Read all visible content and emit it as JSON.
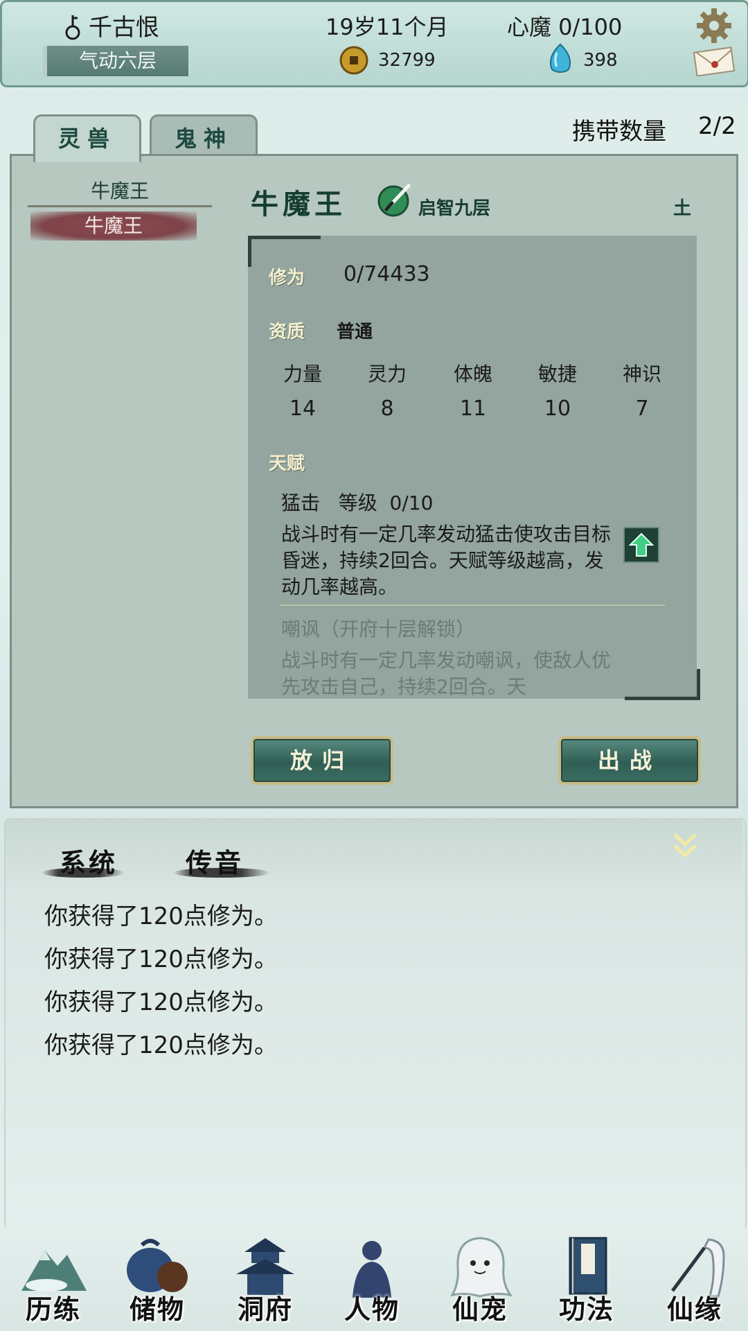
{
  "player": {
    "name": "千古恨",
    "realm": "气动六层",
    "age": "19岁11个月",
    "heart_demon": "心魔  0/100",
    "coins": "32799",
    "gems": "398"
  },
  "tabs": [
    {
      "label": "灵兽",
      "active": true
    },
    {
      "label": "鬼神",
      "active": false
    }
  ],
  "carry": {
    "label": "携带数量",
    "value": "2/2"
  },
  "pet_list": {
    "header": "牛魔王",
    "items": [
      {
        "label": "牛魔王",
        "selected": true
      }
    ]
  },
  "pet": {
    "name": "牛魔王",
    "rank": "启智九层",
    "element": "土",
    "cultivation_label": "修为",
    "cultivation_value": "0/74433",
    "aptitude_label": "资质",
    "aptitude_value": "普通",
    "stats": [
      {
        "name": "力量",
        "value": "14"
      },
      {
        "name": "灵力",
        "value": "8"
      },
      {
        "name": "体魄",
        "value": "11"
      },
      {
        "name": "敏捷",
        "value": "10"
      },
      {
        "name": "神识",
        "value": "7"
      }
    ],
    "talent_label": "天赋",
    "talents": [
      {
        "title": "猛击   等级  0/10",
        "desc": "战斗时有一定几率发动猛击使攻击目标昏迷，持续2回合。天赋等级越高，发动几率越高。",
        "locked": false
      },
      {
        "title": "嘲讽（开府十层解锁）",
        "desc": "战斗时有一定几率发动嘲讽，使敌人优先攻击自己，持续2回合。天",
        "locked": true
      }
    ]
  },
  "actions": {
    "release": "放归",
    "battle": "出战"
  },
  "messages": {
    "channels": [
      "系统",
      "传音"
    ],
    "lines": [
      "你获得了120点修为。",
      "你获得了120点修为。",
      "你获得了120点修为。",
      "你获得了120点修为。"
    ]
  },
  "nav": [
    {
      "label": "历练",
      "icon": "mountain-icon"
    },
    {
      "label": "储物",
      "icon": "pouch-icon"
    },
    {
      "label": "洞府",
      "icon": "pagoda-icon"
    },
    {
      "label": "人物",
      "icon": "person-icon"
    },
    {
      "label": "仙宠",
      "icon": "ghost-pet-icon"
    },
    {
      "label": "功法",
      "icon": "book-icon"
    },
    {
      "label": "仙缘",
      "icon": "crane-icon"
    }
  ],
  "colors": {
    "accent_dark": "#163d32",
    "panel": "#b7c8c1",
    "detail_box": "#93a59e",
    "selected_item": "#7e4449"
  }
}
